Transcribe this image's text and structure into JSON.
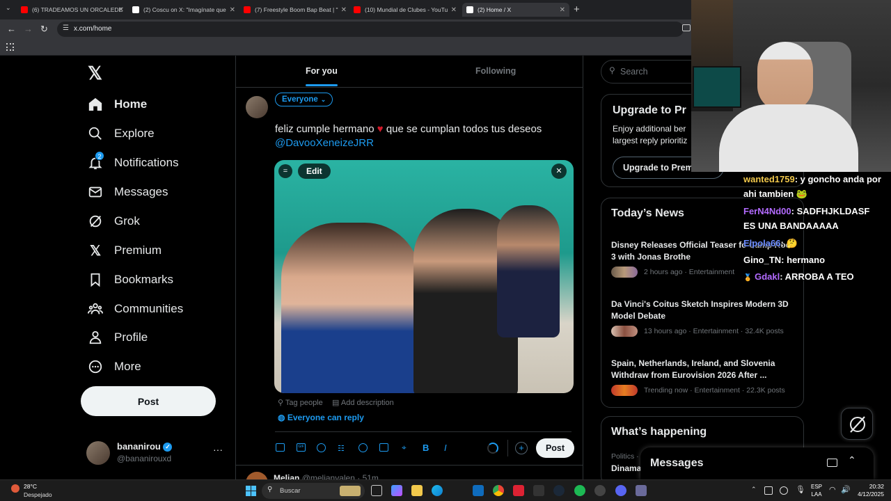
{
  "browser": {
    "tabs": [
      {
        "label": "(6) TRADEAMOS UN ORCALEDE",
        "color": "#ff0000"
      },
      {
        "label": "(2) Coscu on X: \"Imagínate que",
        "color": "#ffffff"
      },
      {
        "label": "(7) Freestyle Boom Bap Beat | \"",
        "color": "#ff0000"
      },
      {
        "label": "(10) Mundial de Clubes - YouTu",
        "color": "#ff0000"
      },
      {
        "label": "(2) Home / X",
        "color": "#ffffff"
      }
    ],
    "url": "x.com/home"
  },
  "nav": {
    "items": [
      {
        "label": "Home",
        "icon": "home-icon"
      },
      {
        "label": "Explore",
        "icon": "search-icon"
      },
      {
        "label": "Notifications",
        "icon": "bell-icon"
      },
      {
        "label": "Messages",
        "icon": "mail-icon"
      },
      {
        "label": "Grok",
        "icon": "grok-icon"
      },
      {
        "label": "Premium",
        "icon": "x-logo-icon"
      },
      {
        "label": "Bookmarks",
        "icon": "bookmark-icon"
      },
      {
        "label": "Communities",
        "icon": "communities-icon"
      },
      {
        "label": "Profile",
        "icon": "person-icon"
      },
      {
        "label": "More",
        "icon": "more-circle-icon"
      }
    ],
    "notifications_badge": "2",
    "post_label": "Post",
    "account": {
      "name": "bananirou",
      "handle": "@bananirouxd"
    }
  },
  "feed": {
    "tabs": [
      "For you",
      "Following"
    ],
    "audience": "Everyone",
    "compose_text": "feliz cumple hermano",
    "compose_text_2": "que se cumplan todos tus deseos",
    "mention": "@DavooXeneizeJRR",
    "edit_label": "Edit",
    "tag_people": "Tag people",
    "add_description": "Add description",
    "reply_setting": "Everyone can reply",
    "post_label": "Post",
    "next_post_name": "Melian",
    "next_post_handle": "@melianvalen",
    "next_post_time": "· 51m"
  },
  "right": {
    "search_placeholder": "Search",
    "upgrade": {
      "title": "Upgrade to Pr",
      "text1": "Enjoy additional ber",
      "text2": "largest reply prioritiz",
      "button": "Upgrade to Prem"
    },
    "news": {
      "title": "Today’s News",
      "items": [
        {
          "title": "Disney Releases Official Teaser fo Camp Rock 3 with Jonas Brothe",
          "meta": "2 hours ago · Entertainment"
        },
        {
          "title": "Da Vinci's Coitus Sketch Inspires Modern 3D Model Debate",
          "meta": "13 hours ago · Entertainment · 32.4K posts"
        },
        {
          "title": "Spain, Netherlands, Ireland, and Slovenia Withdraw from Eurovision 2026 After ...",
          "meta": "Trending now · Entertainment · 22.3K posts"
        }
      ]
    },
    "happening": {
      "title": "What’s happening",
      "sub": "Politics ·",
      "item": "Dinama"
    },
    "messages_drawer": "Messages"
  },
  "chat": [
    {
      "user": "wanted1759",
      "msg": ": y goncho anda por",
      "msg2": "ahi tambien",
      "color": "#f2c94c"
    },
    {
      "user": "FerN4Nd00",
      "msg": ": SADFHJKLDASF",
      "msg2": "ES UNA BANDAAAAA",
      "color": "#b36bff"
    },
    {
      "user": "Elpola66",
      "msg": ":",
      "msg2": "",
      "color": "#6b8cff"
    },
    {
      "user": "Gino_TN",
      "msg": ": hermano",
      "msg2": "",
      "color": "#ffffff"
    },
    {
      "user": "Gdakl",
      "msg": ": ARROBA A TEO",
      "msg2": "",
      "color": "#b36bff"
    }
  ],
  "taskbar": {
    "weather_temp": "28°C",
    "weather_desc": "Despejado",
    "search": "Buscar",
    "lang": "ESP",
    "lang2": "LAA",
    "time": "20:32",
    "date": "4/12/2025"
  }
}
